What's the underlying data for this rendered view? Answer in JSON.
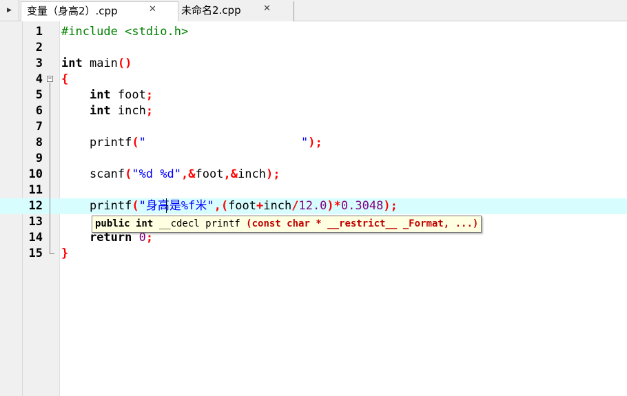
{
  "tabs": [
    {
      "label": "变量（身高2）.cpp",
      "active": true
    },
    {
      "label": "未命名2.cpp",
      "active": false
    }
  ],
  "icons": {
    "tab_scroll": "triangle-right-icon",
    "close": "close-icon",
    "fold": "fold-minus-icon"
  },
  "editor": {
    "current_line": 12,
    "lines": [
      {
        "number": "1",
        "text": "#include <stdio.h>"
      },
      {
        "number": "2",
        "text": ""
      },
      {
        "number": "3",
        "text": "int main()"
      },
      {
        "number": "4",
        "text": "{"
      },
      {
        "number": "5",
        "text": "    int foot;"
      },
      {
        "number": "6",
        "text": "    int inch;"
      },
      {
        "number": "7",
        "text": ""
      },
      {
        "number": "8",
        "text": "    printf(\"                      \");"
      },
      {
        "number": "9",
        "text": ""
      },
      {
        "number": "10",
        "text": "    scanf(\"%d %d\",&foot,&inch);"
      },
      {
        "number": "11",
        "text": ""
      },
      {
        "number": "12",
        "text": "    printf(\"身高是%f米\",(foot+inch/12.0)*0.3048);"
      },
      {
        "number": "13",
        "text": ""
      },
      {
        "number": "14",
        "text": "    return 0;"
      },
      {
        "number": "15",
        "text": "}"
      }
    ],
    "tooltip": {
      "p1": "public int ",
      "p2": "__cdecl printf ",
      "p3": "(const char * __restrict__ _Format, ...)"
    }
  },
  "colors": {
    "keyword": "#000000",
    "preprocessor": "#008000",
    "symbol": "#ff0000",
    "string": "#0000ff",
    "number": "#800080",
    "current_line_bg": "#d7fdff",
    "tooltip_bg": "#ffffe1"
  }
}
